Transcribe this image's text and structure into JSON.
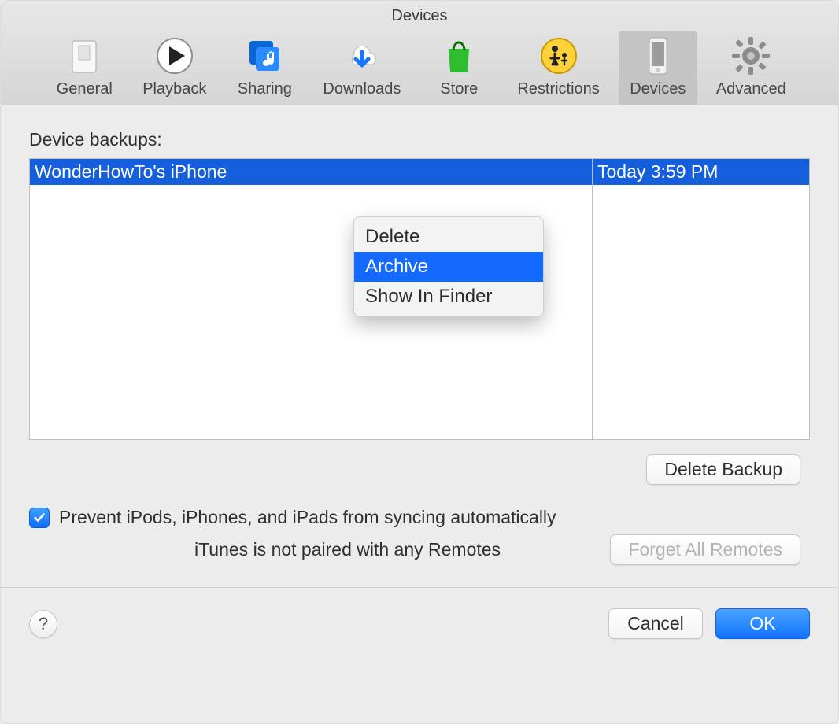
{
  "window": {
    "title": "Devices"
  },
  "toolbar": {
    "items": [
      {
        "label": "General",
        "icon": "switch-icon",
        "active": false
      },
      {
        "label": "Playback",
        "icon": "play-icon",
        "active": false
      },
      {
        "label": "Sharing",
        "icon": "music-share-icon",
        "active": false
      },
      {
        "label": "Downloads",
        "icon": "cloud-download-icon",
        "active": false
      },
      {
        "label": "Store",
        "icon": "shopping-bag-icon",
        "active": false
      },
      {
        "label": "Restrictions",
        "icon": "parental-icon",
        "active": false
      },
      {
        "label": "Devices",
        "icon": "phone-icon",
        "active": true
      },
      {
        "label": "Advanced",
        "icon": "gear-icon",
        "active": false
      }
    ]
  },
  "backups": {
    "section_label": "Device backups:",
    "columns": [
      "name",
      "date"
    ],
    "rows": [
      {
        "name": "WonderHowTo's iPhone",
        "date": "Today 3:59 PM",
        "selected": true
      }
    ],
    "context_menu": {
      "items": [
        {
          "label": "Delete",
          "hover": false
        },
        {
          "label": "Archive",
          "hover": true
        },
        {
          "label": "Show In Finder",
          "hover": false
        }
      ]
    },
    "delete_button": "Delete Backup"
  },
  "prevent_sync": {
    "checked": true,
    "label": "Prevent iPods, iPhones, and iPads from syncing automatically"
  },
  "remotes": {
    "status": "iTunes is not paired with any Remotes",
    "forget_button": "Forget All Remotes",
    "forget_enabled": false
  },
  "footer": {
    "help": "?",
    "cancel": "Cancel",
    "ok": "OK"
  }
}
